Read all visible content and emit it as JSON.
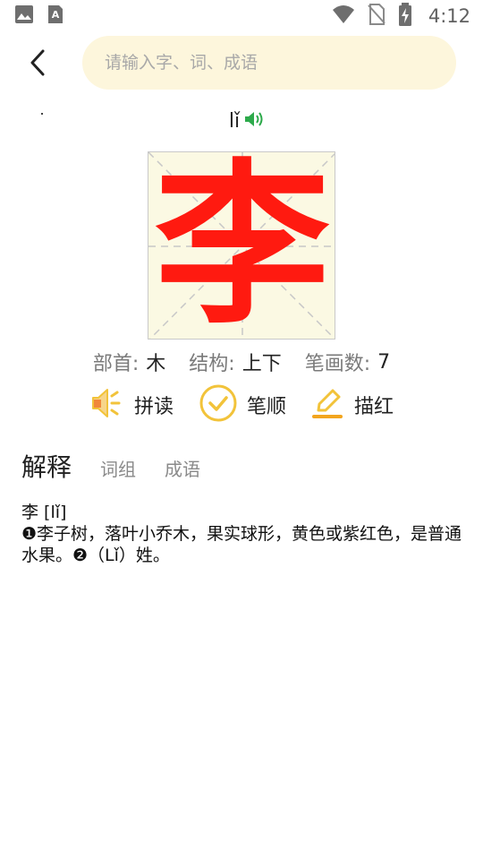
{
  "status_bar": {
    "time": "4:12",
    "left_icons": [
      "image-icon",
      "a-letter-icon"
    ],
    "right_icons": [
      "wifi-icon",
      "no-sim-icon",
      "battery-charging-icon"
    ]
  },
  "header": {
    "search_placeholder": "请输入字、词、成语"
  },
  "character": {
    "char": "李",
    "pinyin": "lǐ",
    "char_color": "#ff1a10"
  },
  "info": {
    "radical_label": "部首:",
    "radical_value": "木",
    "structure_label": "结构:",
    "structure_value": "上下",
    "strokes_label": "笔画数:",
    "strokes_value": "7"
  },
  "actions": {
    "read_label": "拼读",
    "stroke_order_label": "笔顺",
    "trace_label": "描红"
  },
  "tabs": [
    {
      "label": "解释",
      "active": true
    },
    {
      "label": "词组",
      "active": false
    },
    {
      "label": "成语",
      "active": false
    }
  ],
  "definition": {
    "line1": "李 [lǐ]",
    "line2": "❶李子树，落叶小乔木，果实球形，黄色或紫红色，是普通水果。❷（Lǐ）姓。"
  },
  "colors": {
    "search_bg": "#fdf6dc",
    "accent_yellow": "#f2c33a",
    "speaker_green": "#2daa4b"
  }
}
